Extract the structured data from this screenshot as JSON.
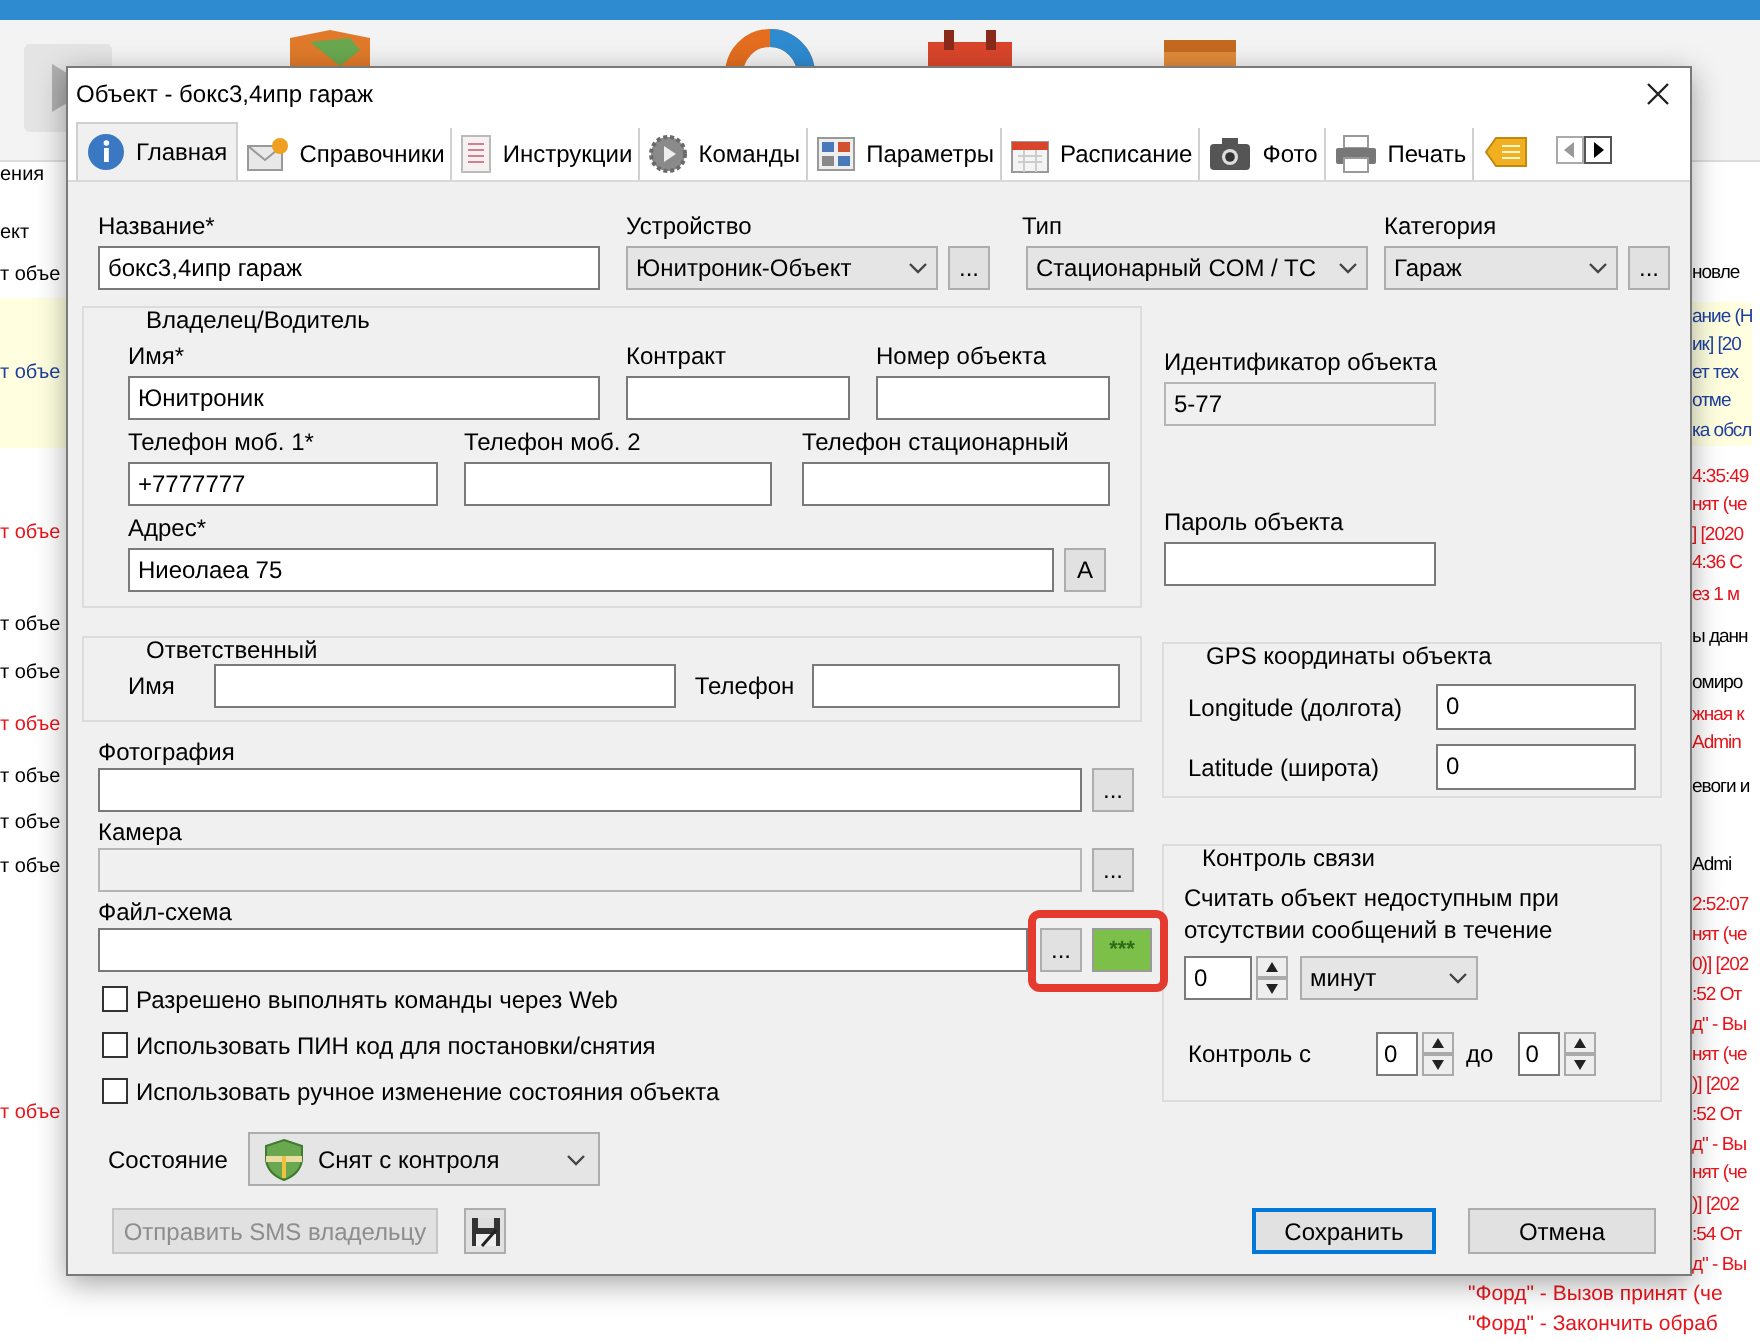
{
  "background": {
    "left_lines": [
      {
        "text": "ения",
        "color": "#000000",
        "highlighted": false
      },
      {
        "text": "ект",
        "color": "#000000",
        "highlighted": false
      },
      {
        "text": "т объе",
        "color": "#000000",
        "highlighted": false
      },
      {
        "text": "т объе",
        "color": "#1f3f9f",
        "highlighted": true
      },
      {
        "text": "т объе",
        "color": "#e8141c",
        "highlighted": false
      },
      {
        "text": "т объе",
        "color": "#000000",
        "highlighted": false
      },
      {
        "text": "т объе",
        "color": "#000000",
        "highlighted": false
      },
      {
        "text": "т объе",
        "color": "#e8141c",
        "highlighted": false
      },
      {
        "text": "т объе",
        "color": "#000000",
        "highlighted": false
      },
      {
        "text": "т объе",
        "color": "#000000",
        "highlighted": false
      },
      {
        "text": "т объе",
        "color": "#000000",
        "highlighted": false
      },
      {
        "text": "т объе",
        "color": "#e8141c",
        "highlighted": false
      }
    ],
    "right_lines": [
      {
        "text": "новле",
        "color": "#000000",
        "highlighted": false
      },
      {
        "text": "ание (Н",
        "color": "#1f3f9f",
        "highlighted": true
      },
      {
        "text": "ик] [20",
        "color": "#1f3f9f",
        "highlighted": true
      },
      {
        "text": "ет тех",
        "color": "#1f3f9f",
        "highlighted": true
      },
      {
        "text": "отме",
        "color": "#1f3f9f",
        "highlighted": true
      },
      {
        "text": "ка обсл",
        "color": "#1f3f9f",
        "highlighted": true
      },
      {
        "text": "4:35:49",
        "color": "#e8141c",
        "highlighted": false
      },
      {
        "text": "нят (че",
        "color": "#e8141c",
        "highlighted": false
      },
      {
        "text": "] [2020",
        "color": "#e8141c",
        "highlighted": false
      },
      {
        "text": "4:36 С",
        "color": "#e8141c",
        "highlighted": false
      },
      {
        "text": "ез 1 м",
        "color": "#e8141c",
        "highlighted": false
      },
      {
        "text": "ы данн",
        "color": "#000000",
        "highlighted": false
      },
      {
        "text": "омиро",
        "color": "#000000",
        "highlighted": false
      },
      {
        "text": "жная к",
        "color": "#e8141c",
        "highlighted": false
      },
      {
        "text": "Admin",
        "color": "#e8141c",
        "highlighted": false
      },
      {
        "text": "евоги и",
        "color": "#000000",
        "highlighted": false
      },
      {
        "text": "Admi",
        "color": "#000000",
        "highlighted": false
      },
      {
        "text": "2:52:07",
        "color": "#e8141c",
        "highlighted": false
      },
      {
        "text": "нят (че",
        "color": "#e8141c",
        "highlighted": false
      },
      {
        "text": "0)] [202",
        "color": "#e8141c",
        "highlighted": false
      },
      {
        "text": ":52 От",
        "color": "#e8141c",
        "highlighted": false
      },
      {
        "text": "д\" - Вы",
        "color": "#e8141c",
        "highlighted": false
      },
      {
        "text": "нят (че",
        "color": "#e8141c",
        "highlighted": false
      },
      {
        "text": ")] [202",
        "color": "#e8141c",
        "highlighted": false
      },
      {
        "text": ":52 От",
        "color": "#e8141c",
        "highlighted": false
      },
      {
        "text": "д\" - Вы",
        "color": "#e8141c",
        "highlighted": false
      },
      {
        "text": "нят (че",
        "color": "#e8141c",
        "highlighted": false
      },
      {
        "text": ")] [202",
        "color": "#e8141c",
        "highlighted": false
      },
      {
        "text": ":54 От",
        "color": "#e8141c",
        "highlighted": false
      },
      {
        "text": "д\" - Вы",
        "color": "#e8141c",
        "highlighted": false
      }
    ],
    "bottom_lines": [
      {
        "text": "\"Форд\" - Вызов принят (че",
        "color": "#e8141c"
      },
      {
        "text": "\"Форд\" - Закончить обраб",
        "color": "#e8141c"
      }
    ]
  },
  "dialog": {
    "title": "Объект - бокс3,4ипр гараж",
    "tabs": [
      {
        "label": "Главная",
        "selected": true
      },
      {
        "label": "Справочники",
        "selected": false
      },
      {
        "label": "Инструкции",
        "selected": false
      },
      {
        "label": "Команды",
        "selected": false
      },
      {
        "label": "Параметры",
        "selected": false
      },
      {
        "label": "Расписание",
        "selected": false
      },
      {
        "label": "Фото",
        "selected": false
      },
      {
        "label": "Печать",
        "selected": false
      }
    ],
    "name": {
      "label": "Название*",
      "value": "бокс3,4ипр гараж"
    },
    "device": {
      "label": "Устройство",
      "value": "Юнитроник-Объект",
      "browse": "..."
    },
    "type": {
      "label": "Тип",
      "value": "Стационарный COM / TC"
    },
    "category": {
      "label": "Категория",
      "value": "Гараж",
      "browse": "..."
    },
    "owner": {
      "title": "Владелец/Водитель",
      "name": {
        "label": "Имя*",
        "value": "Юнитроник"
      },
      "contract": {
        "label": "Контракт"
      },
      "object_number": {
        "label": "Номер объекта"
      },
      "phone1": {
        "label": "Телефон моб. 1*",
        "value": "+7777777"
      },
      "phone2": {
        "label": "Телефон моб. 2"
      },
      "landline": {
        "label": "Телефон стационарный"
      },
      "address": {
        "label": "Адрес*",
        "value": "Ниеолаеа 75",
        "button": "A"
      }
    },
    "responsible": {
      "title": "Ответственный",
      "name_label": "Имя",
      "phone_label": "Телефон"
    },
    "object_id": {
      "label": "Идентификатор объекта",
      "value": "5-77"
    },
    "password": {
      "label": "Пароль объекта"
    },
    "gps": {
      "title": "GPS координаты объекта",
      "longitude": {
        "label": "Longitude (долгота)",
        "value": "0"
      },
      "latitude": {
        "label": "Latitude (широта)",
        "value": "0"
      }
    },
    "photo": {
      "label": "Фотография",
      "browse": "...",
      "disabled": false
    },
    "camera": {
      "label": "Камера",
      "browse": "...",
      "disabled": true
    },
    "scheme": {
      "label": "Файл-схема",
      "browse": "...",
      "preview": "***",
      "highlighted": true
    },
    "options": [
      {
        "label": "Разрешено выполнять команды через Web",
        "checked": false
      },
      {
        "label": "Использовать ПИН код для постановки/снятия",
        "checked": false
      },
      {
        "label": "Использовать ручное изменение состояния объекта",
        "checked": false
      }
    ],
    "state": {
      "label": "Состояние",
      "value": "Снят с контроля"
    },
    "connection": {
      "title": "Контроль связи",
      "description": "Считать объект недоступным при отсутствии сообщений в течение",
      "timeout": "0",
      "unit": "минут",
      "from_label": "Контроль с",
      "from": "0",
      "to_label": "до",
      "to": "0"
    },
    "footer": {
      "sms": {
        "label": "Отправить SMS владельцу",
        "disabled": true
      },
      "save": "Сохранить",
      "cancel": "Отмена"
    }
  }
}
